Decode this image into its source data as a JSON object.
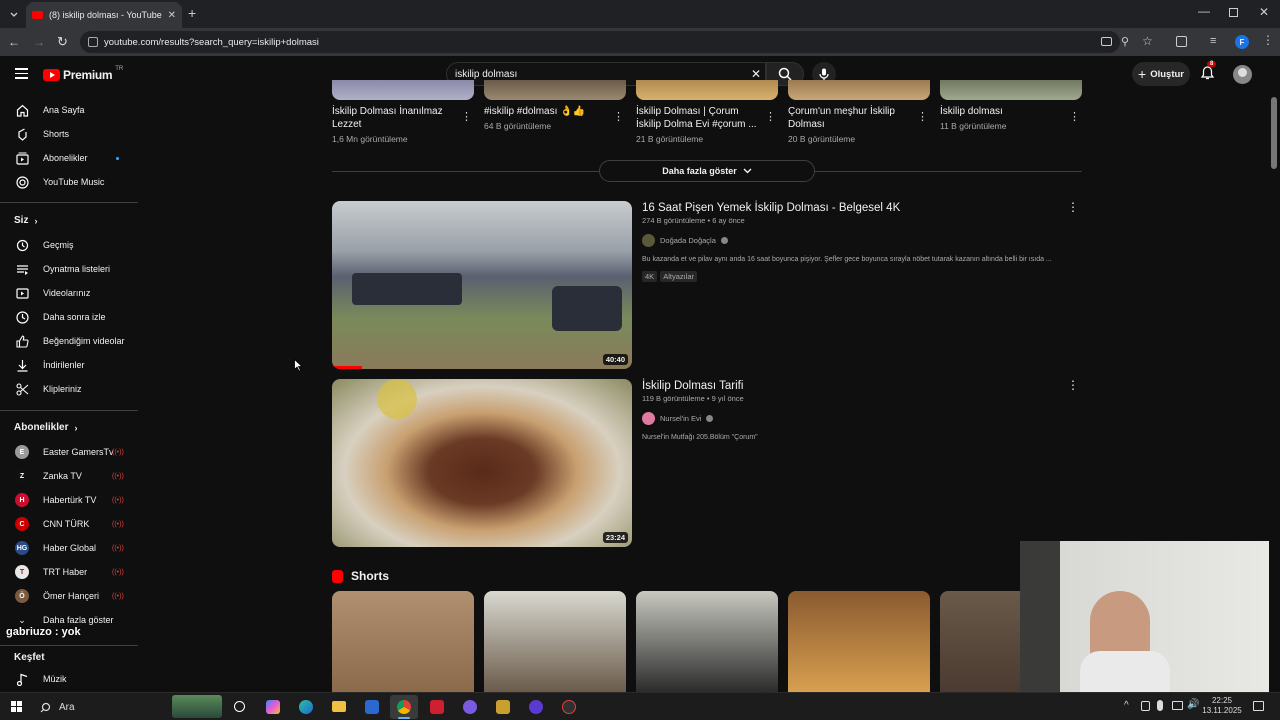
{
  "browser": {
    "tab_title": "(8) iskilip dolması - YouTube",
    "url": "youtube.com/results?search_query=iskilip+dolmasi",
    "profile_initial": "F"
  },
  "header": {
    "logo_text": "Premium",
    "region": "TR",
    "search_value": "iskilip dolması",
    "create_label": "Oluştur",
    "notif_count": "8"
  },
  "sidebar": {
    "main": [
      "Ana Sayfa",
      "Shorts",
      "Abonelikler",
      "YouTube Music"
    ],
    "you_heading": "Siz",
    "you": [
      "Geçmiş",
      "Oynatma listeleri",
      "Videolarınız",
      "Daha sonra izle",
      "Beğendiğim videolar",
      "İndirilenler",
      "Klipleriniz"
    ],
    "subs_heading": "Abonelikler",
    "subs": [
      "Easter GamersTv",
      "Zanka TV",
      "Habertürk TV",
      "CNN TÜRK",
      "Haber Global",
      "TRT Haber",
      "Ömer Hançeri"
    ],
    "show_more": "Daha fazla göster",
    "explore_heading": "Keşfet",
    "explore": [
      "Müzik"
    ]
  },
  "chat_overlay": {
    "user": "gabriuzo",
    "message": ": yok"
  },
  "top_row": [
    {
      "title": "İskilip Dolması İnanılmaz Lezzet",
      "meta": "1,6 Mn görüntüleme"
    },
    {
      "title": "#iskilip #dolması 👌👍",
      "meta": "64 B görüntüleme"
    },
    {
      "title": "İskilip Dolması | Çorum İskilip Dolma Evi #çorum ...",
      "meta": "21 B görüntüleme"
    },
    {
      "title": "Çorum'un meşhur İskilip Dolması",
      "meta": "20 B görüntüleme"
    },
    {
      "title": "İskilip dolması",
      "meta": "11 B görüntüleme"
    }
  ],
  "show_more_label": "Daha fazla göster",
  "videos": [
    {
      "title": "16 Saat Pişen Yemek İskilip Dolması - Belgesel 4K",
      "views": "274 B görüntüleme",
      "age": "6 ay önce",
      "channel": "Doğada Doğaçla",
      "desc": "Bu kazanda et ve pilav aynı anda 16 saat boyunca pişiyor. Şefler gece boyunca sırayla nöbet tutarak kazanın altında belli bir ısıda ...",
      "tags": [
        "4K",
        "Altyazılar"
      ],
      "duration": "40:40"
    },
    {
      "title": "İskilip Dolması Tarifi",
      "views": "119 B görüntüleme",
      "age": "9 yıl önce",
      "channel": "Nursel'in Evi",
      "desc": "Nursel'in Mutfağı 205.Bölüm \"Çorum\"",
      "tags": [],
      "duration": "23:24"
    }
  ],
  "shorts_heading": "Shorts",
  "taskbar": {
    "search": "Ara",
    "time": "22:25",
    "date": "13.11.2025"
  },
  "colors": {
    "bg": "#0f0f0f",
    "accent": "#ff0000"
  }
}
